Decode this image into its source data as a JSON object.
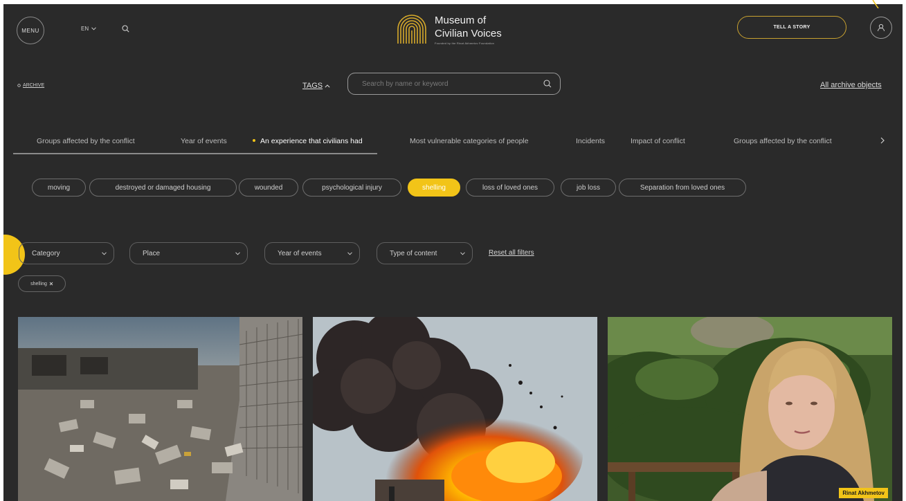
{
  "header": {
    "menu_label": "MENU",
    "language": "EN",
    "logo_line1": "Museum of",
    "logo_line2": "Civilian Voices",
    "logo_sub": "Founded by the Rinat Akhmetov Foundation",
    "tell_story_label": "TELL A STORY"
  },
  "archive_bar": {
    "breadcrumb": "ARCHIVE",
    "tags_label": "TAGS",
    "search_placeholder": "Search by name or keyword",
    "all_archive_label": "All archive objects"
  },
  "tag_categories": [
    {
      "label": "Groups affected by the conflict",
      "active": false
    },
    {
      "label": "Year of events",
      "active": false
    },
    {
      "label": "An experience that civilians had",
      "active": true
    },
    {
      "label": "Most vulnerable categories of people",
      "active": false
    },
    {
      "label": "Incidents",
      "active": false
    },
    {
      "label": "Impact of conflict",
      "active": false
    },
    {
      "label": "Groups affected by the conflict",
      "active": false
    }
  ],
  "tags": [
    {
      "label": "moving",
      "active": false
    },
    {
      "label": "destroyed or damaged housing",
      "active": false
    },
    {
      "label": "wounded",
      "active": false
    },
    {
      "label": "psychological injury",
      "active": false
    },
    {
      "label": "shelling",
      "active": true
    },
    {
      "label": "loss of loved ones",
      "active": false
    },
    {
      "label": "job loss",
      "active": false
    },
    {
      "label": "Separation from loved ones",
      "active": false
    }
  ],
  "filters": [
    {
      "label": "Category"
    },
    {
      "label": "Place"
    },
    {
      "label": "Year of events"
    },
    {
      "label": "Type of content"
    }
  ],
  "reset_label": "Reset all filters",
  "active_chip": "shelling",
  "cards": [
    {
      "image": "destroyed-building-rubble"
    },
    {
      "image": "explosion-fire-smoke"
    },
    {
      "image": "woman-interview-outdoors",
      "caption": "Rinat Akhmetov"
    }
  ],
  "colors": {
    "background": "#2a2a2a",
    "accent": "#f2c418",
    "button_border": "#c9a230"
  }
}
